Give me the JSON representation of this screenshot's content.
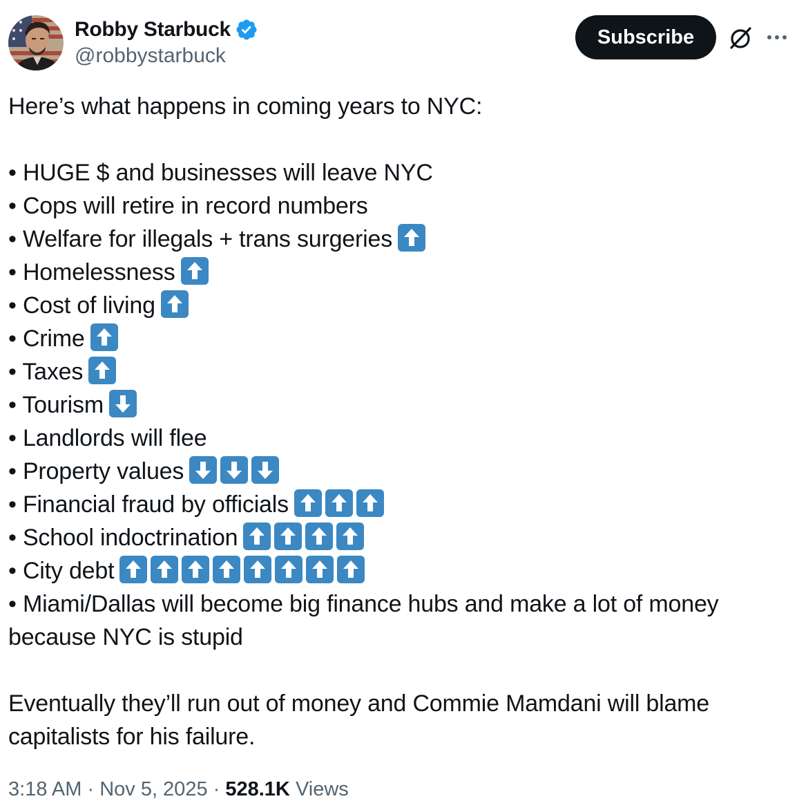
{
  "author": {
    "display_name": "Robby Starbuck",
    "handle": "@robbystarbuck",
    "verified": true,
    "verified_color": "#1d9bf0"
  },
  "actions": {
    "subscribe_label": "Subscribe",
    "grok_icon": "grok-icon",
    "more_icon": "more-icon"
  },
  "tweet": {
    "intro": "Here’s what happens in coming years to NYC:",
    "items": [
      {
        "text": "• HUGE $ and businesses will leave NYC",
        "arrows": []
      },
      {
        "text": "• Cops will retire in record numbers",
        "arrows": []
      },
      {
        "text": "• Welfare for illegals + trans surgeries",
        "arrows": [
          "up"
        ]
      },
      {
        "text": "• Homelessness",
        "arrows": [
          "up"
        ]
      },
      {
        "text": "• Cost of living",
        "arrows": [
          "up"
        ]
      },
      {
        "text": "• Crime",
        "arrows": [
          "up"
        ]
      },
      {
        "text": "• Taxes",
        "arrows": [
          "up"
        ]
      },
      {
        "text": "• Tourism",
        "arrows": [
          "down"
        ]
      },
      {
        "text": "• Landlords will flee",
        "arrows": []
      },
      {
        "text": "• Property values",
        "arrows": [
          "down",
          "down",
          "down"
        ]
      },
      {
        "text": "• Financial fraud by officials",
        "arrows": [
          "up",
          "up",
          "up"
        ]
      },
      {
        "text": "• School indoctrination",
        "arrows": [
          "up",
          "up",
          "up",
          "up"
        ]
      },
      {
        "text": "• City debt",
        "arrows": [
          "up",
          "up",
          "up",
          "up",
          "up",
          "up",
          "up",
          "up"
        ]
      },
      {
        "text": "• Miami/Dallas will become big finance hubs and make a lot of money because NYC is stupid",
        "arrows": []
      }
    ],
    "closing": "Eventually they’ll run out of money and Commie Mamdani will blame capitalists for his failure."
  },
  "meta": {
    "time": "3:18 AM",
    "separator": "·",
    "date": "Nov 5, 2025",
    "views_count": "528.1K",
    "views_label": "Views"
  },
  "colors": {
    "text": "#0f1419",
    "secondary": "#536471",
    "arrow_emoji_bg": "#3b88c3"
  }
}
